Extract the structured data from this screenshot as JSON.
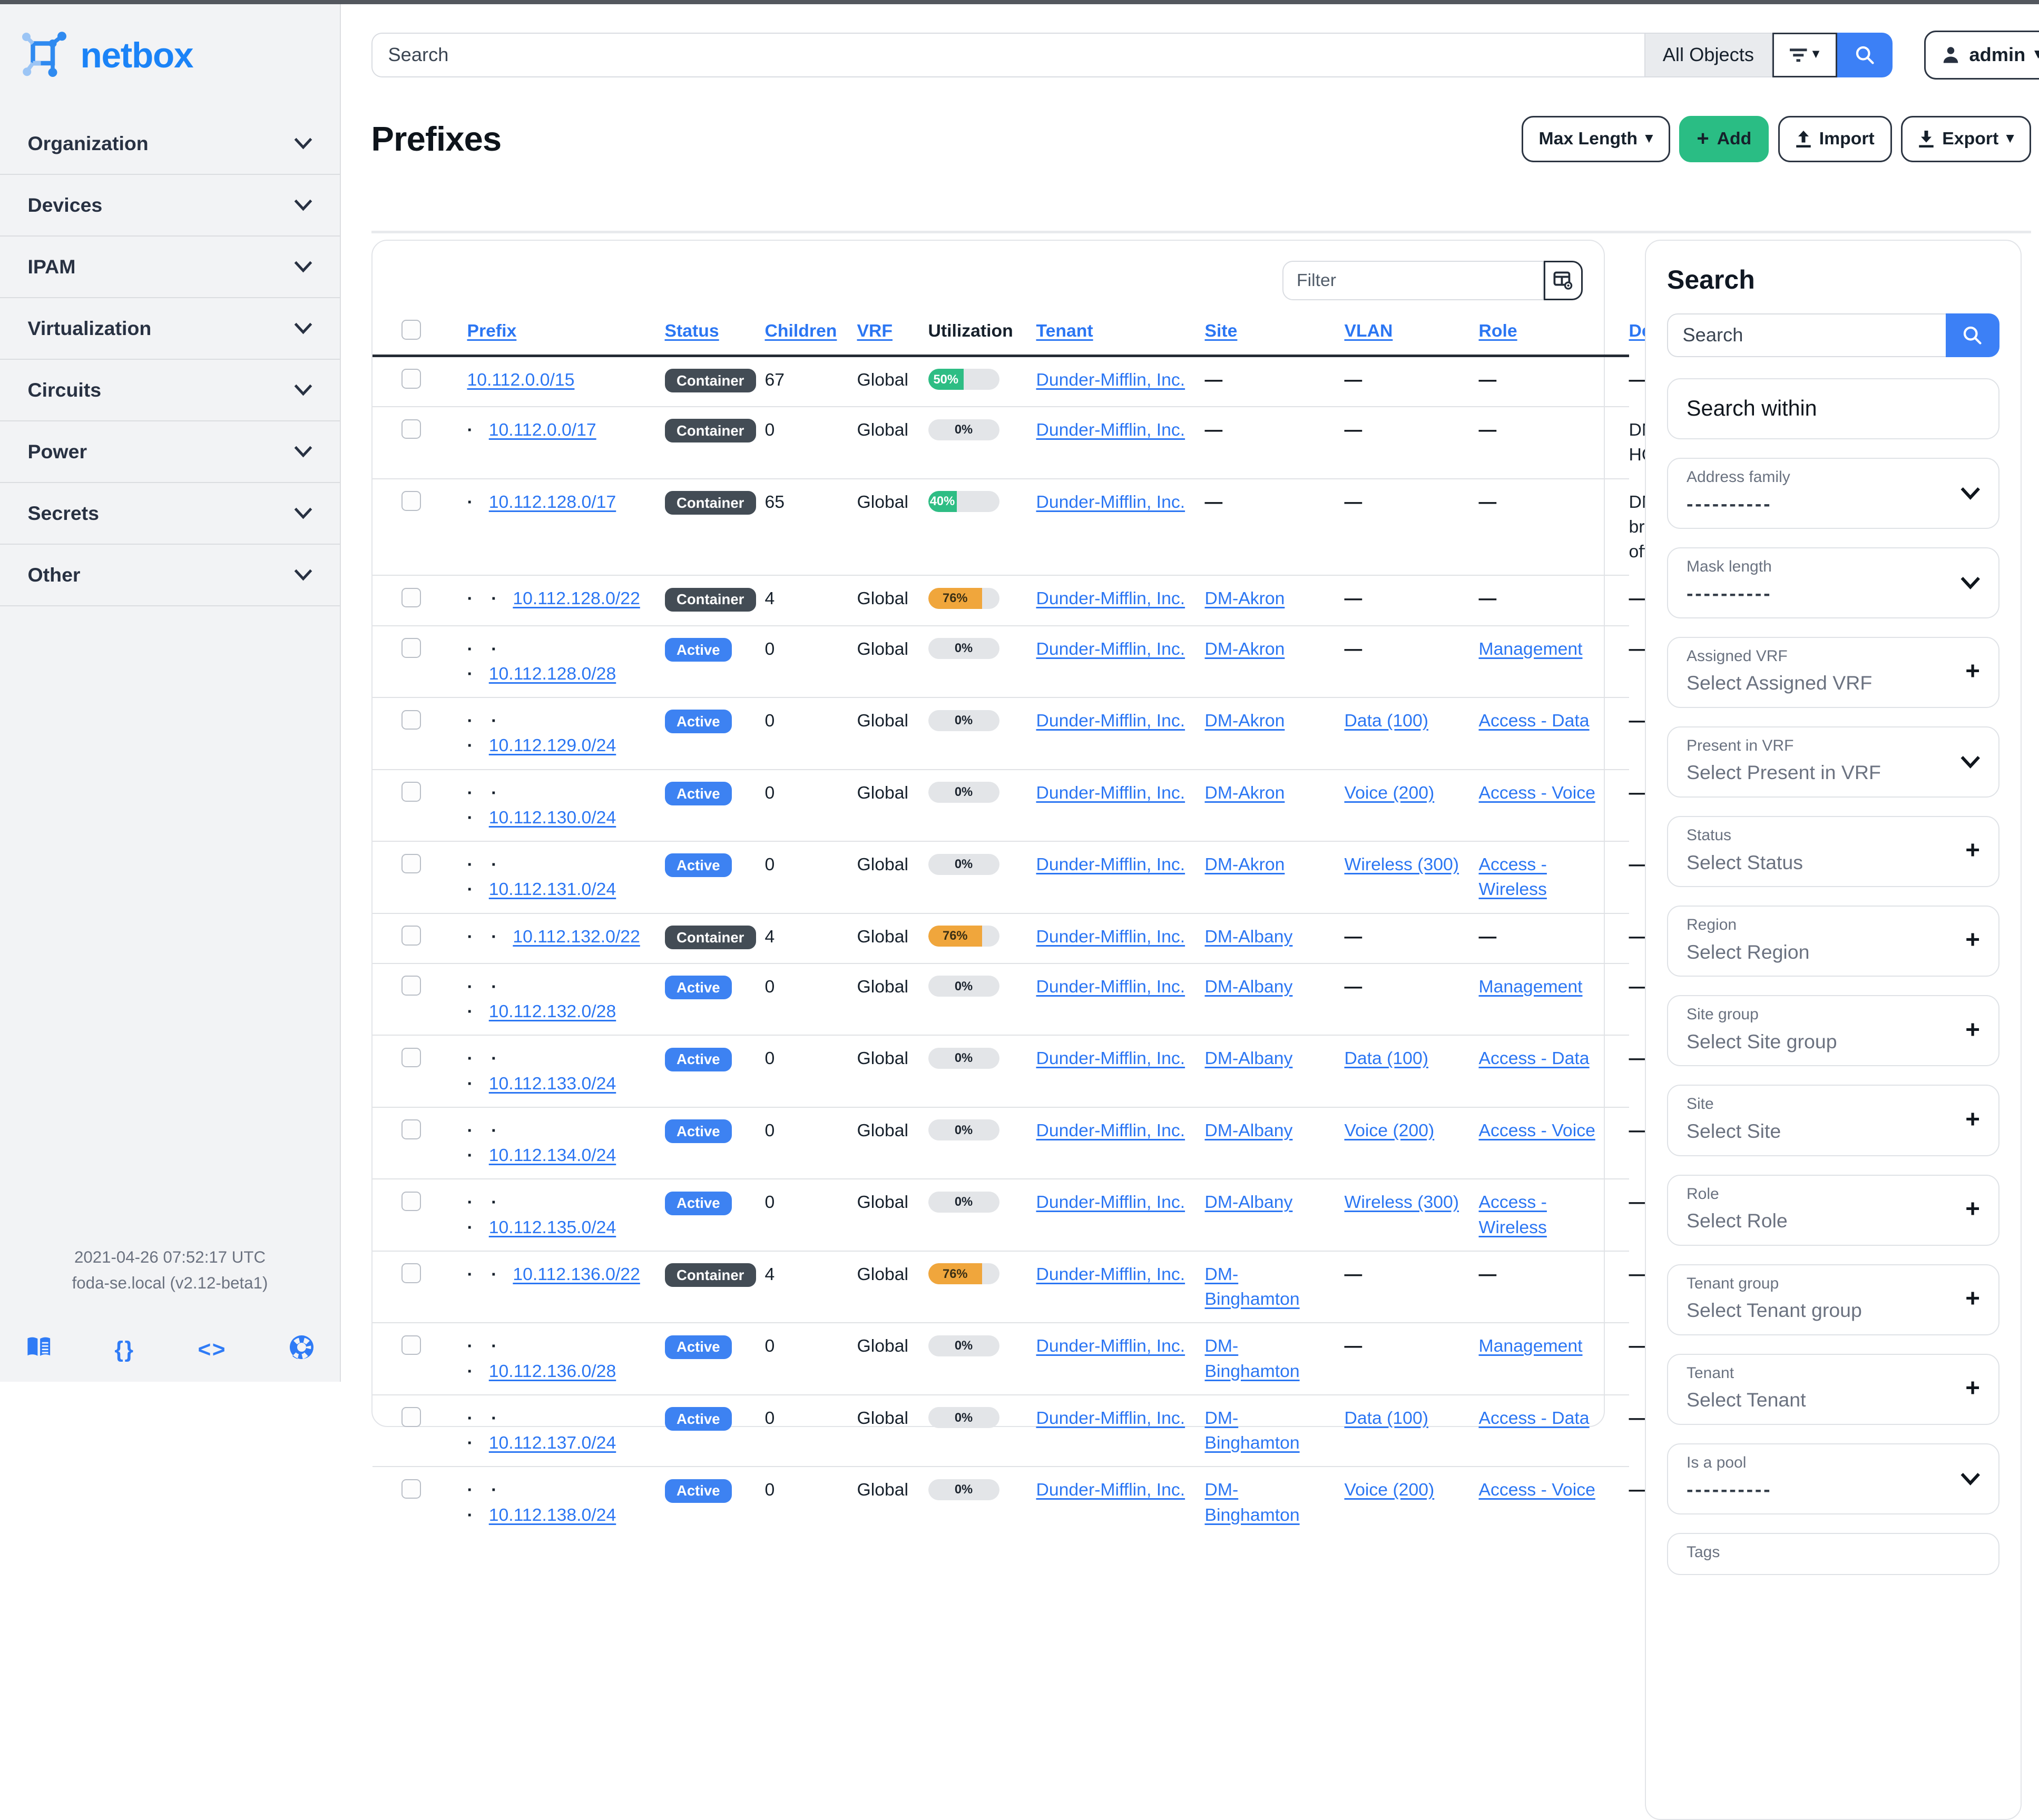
{
  "brand": {
    "name": "netbox"
  },
  "topbar": {
    "search_placeholder": "Search",
    "scope_label": "All Objects",
    "user_label": "admin"
  },
  "page": {
    "title": "Prefixes",
    "actions": {
      "max_length": "Max Length",
      "add": "Add",
      "import": "Import",
      "export": "Export"
    }
  },
  "sidebar": {
    "items": [
      {
        "label": "Organization"
      },
      {
        "label": "Devices"
      },
      {
        "label": "IPAM"
      },
      {
        "label": "Virtualization"
      },
      {
        "label": "Circuits"
      },
      {
        "label": "Power"
      },
      {
        "label": "Secrets"
      },
      {
        "label": "Other"
      }
    ],
    "footer": {
      "timestamp": "2021-04-26 07:52:17 UTC",
      "host_version": "foda-se.local (v2.12-beta1)",
      "braces_glyph": "{}",
      "code_glyph": "<>"
    }
  },
  "table": {
    "filter_placeholder": "Filter",
    "columns": [
      {
        "label": "Prefix",
        "sortable": true
      },
      {
        "label": "Status",
        "sortable": true
      },
      {
        "label": "Children",
        "sortable": true
      },
      {
        "label": "VRF",
        "sortable": true
      },
      {
        "label": "Utilization",
        "sortable": false
      },
      {
        "label": "Tenant",
        "sortable": true
      },
      {
        "label": "Site",
        "sortable": true
      },
      {
        "label": "VLAN",
        "sortable": true
      },
      {
        "label": "Role",
        "sortable": true
      },
      {
        "label": "Description",
        "sortable": true
      }
    ],
    "rows": [
      {
        "prefix": "10.112.0.0/15",
        "depth": 0,
        "status": "Container",
        "children": "67",
        "vrf": "Global",
        "utilization": 50,
        "util_color": "green",
        "tenant": "Dunder-Mifflin, Inc.",
        "site": "",
        "vlan": "",
        "role": "",
        "description": ""
      },
      {
        "prefix": "10.112.0.0/17",
        "depth": 1,
        "status": "Container",
        "children": "0",
        "vrf": "Global",
        "utilization": 0,
        "util_color": "gray",
        "tenant": "Dunder-Mifflin, Inc.",
        "site": "",
        "vlan": "",
        "role": "",
        "description": "DM HQ"
      },
      {
        "prefix": "10.112.128.0/17",
        "depth": 1,
        "status": "Container",
        "children": "65",
        "vrf": "Global",
        "utilization": 40,
        "util_color": "green",
        "tenant": "Dunder-Mifflin, Inc.",
        "site": "",
        "vlan": "",
        "role": "",
        "description": "DM branch offices"
      },
      {
        "prefix": "10.112.128.0/22",
        "depth": 2,
        "status": "Container",
        "children": "4",
        "vrf": "Global",
        "utilization": 76,
        "util_color": "orange",
        "tenant": "Dunder-Mifflin, Inc.",
        "site": "DM-Akron",
        "vlan": "",
        "role": "",
        "description": ""
      },
      {
        "prefix": "10.112.128.0/28",
        "depth": 3,
        "status": "Active",
        "children": "0",
        "vrf": "Global",
        "utilization": 0,
        "util_color": "gray",
        "tenant": "Dunder-Mifflin, Inc.",
        "site": "DM-Akron",
        "vlan": "",
        "role": "Management",
        "description": ""
      },
      {
        "prefix": "10.112.129.0/24",
        "depth": 3,
        "status": "Active",
        "children": "0",
        "vrf": "Global",
        "utilization": 0,
        "util_color": "gray",
        "tenant": "Dunder-Mifflin, Inc.",
        "site": "DM-Akron",
        "vlan": "Data (100)",
        "role": "Access - Data",
        "description": ""
      },
      {
        "prefix": "10.112.130.0/24",
        "depth": 3,
        "status": "Active",
        "children": "0",
        "vrf": "Global",
        "utilization": 0,
        "util_color": "gray",
        "tenant": "Dunder-Mifflin, Inc.",
        "site": "DM-Akron",
        "vlan": "Voice (200)",
        "role": "Access - Voice",
        "description": ""
      },
      {
        "prefix": "10.112.131.0/24",
        "depth": 3,
        "status": "Active",
        "children": "0",
        "vrf": "Global",
        "utilization": 0,
        "util_color": "gray",
        "tenant": "Dunder-Mifflin, Inc.",
        "site": "DM-Akron",
        "vlan": "Wireless (300)",
        "role": "Access - Wireless",
        "description": ""
      },
      {
        "prefix": "10.112.132.0/22",
        "depth": 2,
        "status": "Container",
        "children": "4",
        "vrf": "Global",
        "utilization": 76,
        "util_color": "orange",
        "tenant": "Dunder-Mifflin, Inc.",
        "site": "DM-Albany",
        "vlan": "",
        "role": "",
        "description": ""
      },
      {
        "prefix": "10.112.132.0/28",
        "depth": 3,
        "status": "Active",
        "children": "0",
        "vrf": "Global",
        "utilization": 0,
        "util_color": "gray",
        "tenant": "Dunder-Mifflin, Inc.",
        "site": "DM-Albany",
        "vlan": "",
        "role": "Management",
        "description": ""
      },
      {
        "prefix": "10.112.133.0/24",
        "depth": 3,
        "status": "Active",
        "children": "0",
        "vrf": "Global",
        "utilization": 0,
        "util_color": "gray",
        "tenant": "Dunder-Mifflin, Inc.",
        "site": "DM-Albany",
        "vlan": "Data (100)",
        "role": "Access - Data",
        "description": ""
      },
      {
        "prefix": "10.112.134.0/24",
        "depth": 3,
        "status": "Active",
        "children": "0",
        "vrf": "Global",
        "utilization": 0,
        "util_color": "gray",
        "tenant": "Dunder-Mifflin, Inc.",
        "site": "DM-Albany",
        "vlan": "Voice (200)",
        "role": "Access - Voice",
        "description": ""
      },
      {
        "prefix": "10.112.135.0/24",
        "depth": 3,
        "status": "Active",
        "children": "0",
        "vrf": "Global",
        "utilization": 0,
        "util_color": "gray",
        "tenant": "Dunder-Mifflin, Inc.",
        "site": "DM-Albany",
        "vlan": "Wireless (300)",
        "role": "Access - Wireless",
        "description": ""
      },
      {
        "prefix": "10.112.136.0/22",
        "depth": 2,
        "status": "Container",
        "children": "4",
        "vrf": "Global",
        "utilization": 76,
        "util_color": "orange",
        "tenant": "Dunder-Mifflin, Inc.",
        "site": "DM-Binghamton",
        "vlan": "",
        "role": "",
        "description": ""
      },
      {
        "prefix": "10.112.136.0/28",
        "depth": 3,
        "status": "Active",
        "children": "0",
        "vrf": "Global",
        "utilization": 0,
        "util_color": "gray",
        "tenant": "Dunder-Mifflin, Inc.",
        "site": "DM-Binghamton",
        "vlan": "",
        "role": "Management",
        "description": ""
      },
      {
        "prefix": "10.112.137.0/24",
        "depth": 3,
        "status": "Active",
        "children": "0",
        "vrf": "Global",
        "utilization": 0,
        "util_color": "gray",
        "tenant": "Dunder-Mifflin, Inc.",
        "site": "DM-Binghamton",
        "vlan": "Data (100)",
        "role": "Access - Data",
        "description": ""
      },
      {
        "prefix": "10.112.138.0/24",
        "depth": 3,
        "status": "Active",
        "children": "0",
        "vrf": "Global",
        "utilization": 0,
        "util_color": "gray",
        "tenant": "Dunder-Mifflin, Inc.",
        "site": "DM-Binghamton",
        "vlan": "Voice (200)",
        "role": "Access - Voice",
        "description": ""
      }
    ]
  },
  "filter_panel": {
    "title": "Search",
    "search_placeholder": "Search",
    "search_within": "Search within",
    "null_option": "----------",
    "fields": [
      {
        "label": "Address family",
        "value": "----------",
        "dashes": true,
        "icon": "chevron"
      },
      {
        "label": "Mask length",
        "value": "----------",
        "dashes": true,
        "icon": "chevron"
      },
      {
        "label": "Assigned VRF",
        "value": "Select Assigned VRF",
        "dashes": false,
        "icon": "plus"
      },
      {
        "label": "Present in VRF",
        "value": "Select Present in VRF",
        "dashes": false,
        "icon": "chevron"
      },
      {
        "label": "Status",
        "value": "Select Status",
        "dashes": false,
        "icon": "plus"
      },
      {
        "label": "Region",
        "value": "Select Region",
        "dashes": false,
        "icon": "plus"
      },
      {
        "label": "Site group",
        "value": "Select Site group",
        "dashes": false,
        "icon": "plus"
      },
      {
        "label": "Site",
        "value": "Select Site",
        "dashes": false,
        "icon": "plus"
      },
      {
        "label": "Role",
        "value": "Select Role",
        "dashes": false,
        "icon": "plus"
      },
      {
        "label": "Tenant group",
        "value": "Select Tenant group",
        "dashes": false,
        "icon": "plus"
      },
      {
        "label": "Tenant",
        "value": "Select Tenant",
        "dashes": false,
        "icon": "plus"
      },
      {
        "label": "Is a pool",
        "value": "----------",
        "dashes": true,
        "icon": "chevron"
      },
      {
        "label": "Tags",
        "value": "",
        "dashes": false,
        "icon": "none"
      }
    ]
  },
  "colors": {
    "link_blue": "#2b76f3",
    "badge_active": "#3d82f2",
    "badge_container": "#434c55",
    "util_green": "#2ebd84",
    "util_orange": "#f0a63c",
    "button_green": "#2abd84",
    "accent_blue": "#3c80f6"
  }
}
